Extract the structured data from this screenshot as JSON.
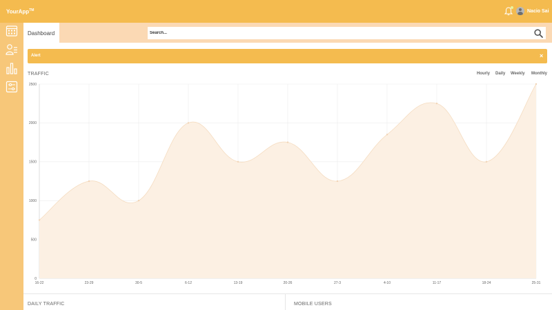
{
  "topbar": {
    "brand": "YourApp",
    "brand_mark": "TM",
    "notifications_icon": "bell-icon",
    "user_name": "Nacio Sai"
  },
  "sidebar": {
    "items": [
      {
        "icon": "calendar-icon"
      },
      {
        "icon": "users-list-icon"
      },
      {
        "icon": "bar-chart-icon"
      },
      {
        "icon": "settings-sliders-icon"
      }
    ]
  },
  "header": {
    "tab_label": "Dashboard",
    "search_placeholder": "Search...",
    "search_icon": "search-icon"
  },
  "alert": {
    "text": "Alert",
    "close_label": "×"
  },
  "traffic": {
    "title": "TRAFFIC",
    "ranges": [
      "Hourly",
      "Daily",
      "Weekly",
      "Monthly"
    ]
  },
  "chart_data": {
    "type": "area",
    "title": "TRAFFIC",
    "categories": [
      "16-22",
      "23-29",
      "30-5",
      "6-12",
      "13-19",
      "20-26",
      "27-3",
      "4-10",
      "11-17",
      "18-24",
      "25-31"
    ],
    "values": [
      750,
      1250,
      1000,
      2000,
      1500,
      1750,
      1250,
      1850,
      2250,
      1500,
      2500
    ],
    "y_ticks": [
      0,
      500,
      1000,
      1500,
      2000,
      2500
    ],
    "ylim": [
      0,
      2500
    ],
    "grid": true,
    "legend": "none"
  },
  "bottom": {
    "daily_title": "DAILY TRAFFIC",
    "mobile_title": "MOBILE USERS"
  },
  "colors": {
    "accent": "#f4bb4f",
    "sidebar": "#f7c779",
    "header_band": "#fbd9b4",
    "chart_fill": "#fcf0e3",
    "chart_line": "#f5dcc0"
  }
}
